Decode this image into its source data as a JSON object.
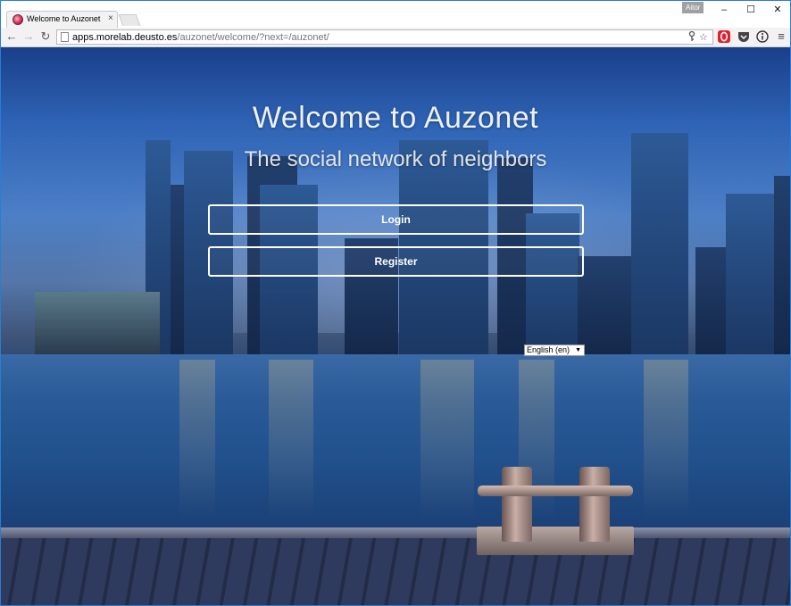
{
  "browser": {
    "tab_title": "Welcome to Auzonet",
    "tab_close": "×",
    "profile_name": "Aitor",
    "window_controls": {
      "minimize": "–",
      "maximize": "☐",
      "close": "✕"
    },
    "nav": {
      "back": "←",
      "forward": "→",
      "reload": "↻"
    },
    "url_host": "apps.morelab.deusto.es",
    "url_path": "/auzonet/welcome/?next=/auzonet/",
    "menu_icon": "≡"
  },
  "page": {
    "title": "Welcome to Auzonet",
    "subtitle": "The social network of neighbors",
    "login_label": "Login",
    "register_label": "Register",
    "language": {
      "selected": "English (en)",
      "arrow": "▼"
    }
  },
  "colors": {
    "window_border": "#2b7cd3",
    "button_border": "#ffffff"
  }
}
